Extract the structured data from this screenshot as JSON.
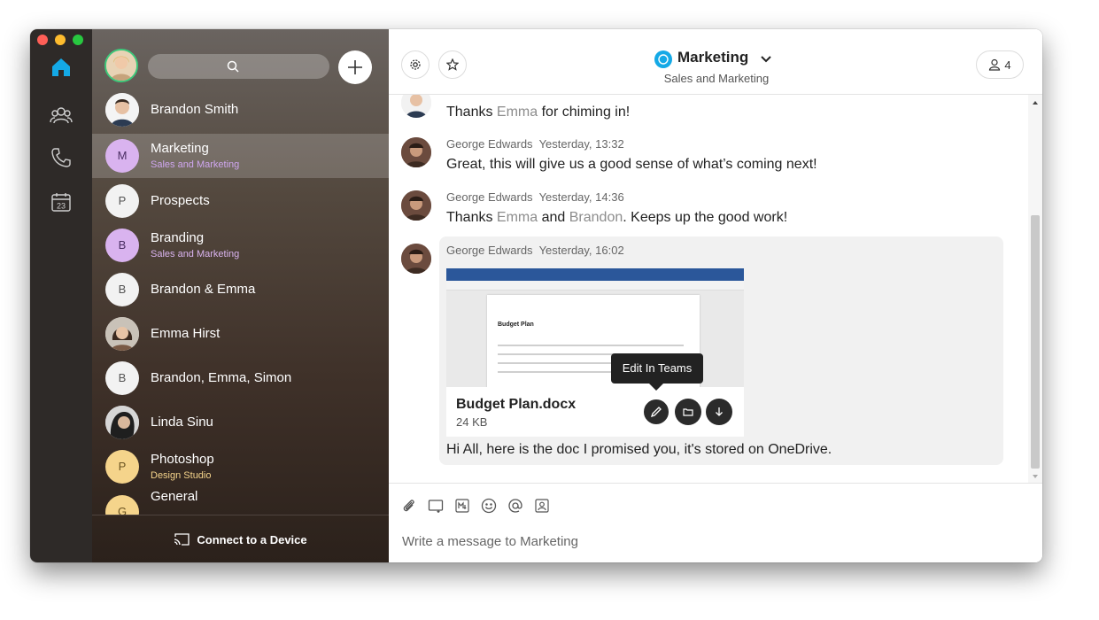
{
  "window": {
    "traffic_lights": [
      "#ff5f57",
      "#febc2e",
      "#28c840"
    ]
  },
  "rail": {
    "items": [
      {
        "icon": "home-icon",
        "active": true
      },
      {
        "icon": "teams-icon"
      },
      {
        "icon": "phone-icon"
      },
      {
        "icon": "calendar-icon",
        "label": "23"
      }
    ],
    "accent": "#14a9e6"
  },
  "sidebar": {
    "search": {
      "placeholder": ""
    },
    "items": [
      {
        "name": "Brandon Smith",
        "subtitle": "",
        "initial": "",
        "avatar": "photo"
      },
      {
        "name": "Marketing",
        "subtitle": "Sales and Marketing",
        "initial": "M",
        "avatar_color": "#d9b3ef",
        "subtitle_color": "#cfa6ef",
        "active": true
      },
      {
        "name": "Prospects",
        "subtitle": "",
        "initial": "P",
        "avatar_color": "#f2f2f2"
      },
      {
        "name": "Branding",
        "subtitle": "Sales and Marketing",
        "initial": "B",
        "avatar_color": "#d9b3ef",
        "subtitle_color": "#d9b3ef"
      },
      {
        "name": "Brandon & Emma",
        "subtitle": "",
        "initial": "B",
        "avatar_color": "#f2f2f2"
      },
      {
        "name": "Emma Hirst",
        "subtitle": "",
        "initial": "",
        "avatar": "photo"
      },
      {
        "name": "Brandon, Emma, Simon",
        "subtitle": "",
        "initial": "B",
        "avatar_color": "#f2f2f2"
      },
      {
        "name": "Linda Sinu",
        "subtitle": "",
        "initial": "",
        "avatar": "photo"
      },
      {
        "name": "Photoshop",
        "subtitle": "Design Studio",
        "initial": "P",
        "avatar_color": "#f5d48b",
        "subtitle_color": "#f5d48b"
      },
      {
        "name": "General",
        "subtitle": "",
        "initial": "G",
        "avatar_color": "#f5d48b"
      }
    ],
    "footer_label": "Connect to a Device"
  },
  "header": {
    "space_name": "Marketing",
    "space_subtitle": "Sales and Marketing",
    "participants_count": "4",
    "space_icon_color": "#14a9e6"
  },
  "messages": [
    {
      "author": "",
      "time": "",
      "parts": [
        {
          "t": "Thanks "
        },
        {
          "t": "Emma",
          "mention": true
        },
        {
          "t": " for chiming in!"
        }
      ]
    },
    {
      "author": "George Edwards",
      "time": "Yesterday, 13:32",
      "parts": [
        {
          "t": "Great, this will give us a good sense of what’s coming next!"
        }
      ]
    },
    {
      "author": "George Edwards",
      "time": "Yesterday, 14:36",
      "parts": [
        {
          "t": "Thanks "
        },
        {
          "t": "Emma",
          "mention": true
        },
        {
          "t": " and "
        },
        {
          "t": "Brandon",
          "mention": true
        },
        {
          "t": ". Keeps up the good work!"
        }
      ]
    },
    {
      "author": "George Edwards",
      "time": "Yesterday, 16:02",
      "parts": [
        {
          "t": "Hi All, here is the doc I promised you, it's stored on OneDrive."
        }
      ]
    }
  ],
  "attachment": {
    "preview_title": "Budget Plan",
    "name": "Budget Plan.docx",
    "size": "24 KB",
    "tooltip": "Edit In Teams",
    "actions": [
      "edit-icon",
      "folder-icon",
      "download-icon"
    ]
  },
  "composer": {
    "placeholder": "Write a message to Marketing",
    "tools": [
      "attach-icon",
      "share-screen-icon",
      "markdown-icon",
      "emoji-icon",
      "mention-icon",
      "contact-icon"
    ]
  }
}
